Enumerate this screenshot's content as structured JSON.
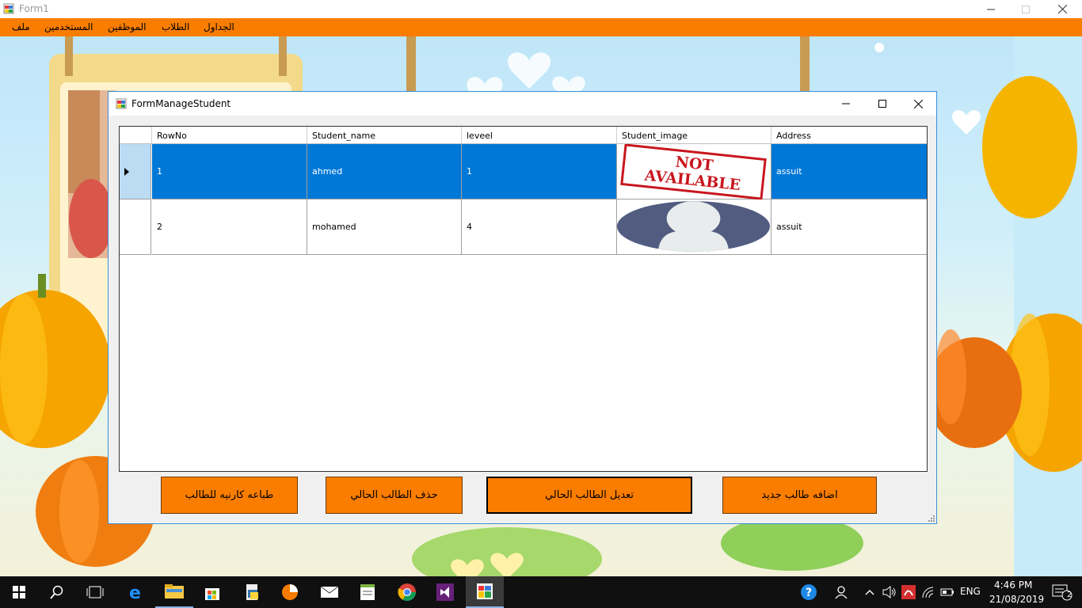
{
  "main_window": {
    "title": "Form1"
  },
  "menu": {
    "items": [
      "ملف",
      "المستخدمين",
      "الموظفين",
      "الطلاب",
      "الجداول"
    ]
  },
  "child_window": {
    "title": "FormManageStudent"
  },
  "grid": {
    "columns": [
      "RowNo",
      "Student_name",
      "leveel",
      "Student_image",
      "Address"
    ],
    "rows": [
      {
        "RowNo": "1",
        "Student_name": "ahmed",
        "leveel": "1",
        "image": "NOT AVAILABLE",
        "Address": "assuit",
        "selected": true
      },
      {
        "RowNo": "2",
        "Student_name": "mohamed",
        "leveel": "4",
        "image": "avatar",
        "Address": "assuit",
        "selected": false
      }
    ]
  },
  "buttons": {
    "print": "طباعه كارنيه للطالب",
    "delete": "حذف الطالب الحالي",
    "edit": "تعديل الطالب الحالي",
    "add": "اضافه طالب جديد"
  },
  "not_available": {
    "line1": "NOT",
    "line2": "AVAILABLE"
  },
  "taskbar": {
    "lang": "ENG",
    "time": "4:46 PM",
    "date": "21/08/2019",
    "notifications": "2"
  },
  "colors": {
    "accent": "#fb7d00",
    "selection": "#0078d7"
  }
}
